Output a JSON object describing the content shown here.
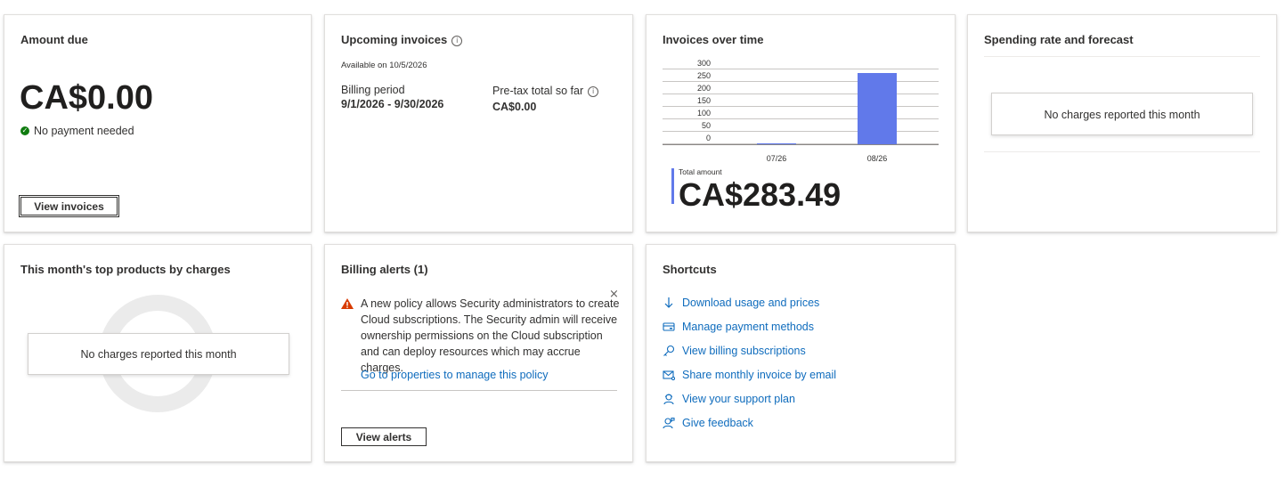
{
  "amount_due": {
    "title": "Amount due",
    "amount": "CA$0.00",
    "status": "No payment needed",
    "button": "View invoices"
  },
  "upcoming": {
    "title": "Upcoming invoices",
    "available": "Available on 10/5/2026",
    "billing_period_label": "Billing period",
    "billing_period_value": "9/1/2026 - 9/30/2026",
    "pretax_label": "Pre-tax total so far",
    "pretax_value": "CA$0.00"
  },
  "invoices_over_time": {
    "title": "Invoices over time",
    "total_label": "Total amount",
    "total_value": "CA$283.49"
  },
  "chart_data": {
    "type": "bar",
    "categories": [
      "07/26",
      "08/26"
    ],
    "values": [
      0,
      283.49
    ],
    "ylim": [
      0,
      300
    ],
    "yticks": [
      "300",
      "250",
      "200",
      "150",
      "100",
      "50",
      "0"
    ],
    "bar_color": "#6179ea",
    "grid": true
  },
  "spending": {
    "title": "Spending rate and forecast",
    "empty": "No charges reported this month"
  },
  "top_products": {
    "title": "This month's top products by charges",
    "empty": "No charges reported this month"
  },
  "alerts": {
    "title": "Billing alerts (1)",
    "message": "A new policy allows Security administrators to create Cloud subscriptions. The Security admin will receive ownership permissions on the Cloud subscription and can deploy resources which may accrue charges.",
    "link": "Go to properties to manage this policy",
    "button": "View alerts",
    "close": "×"
  },
  "shortcuts": {
    "title": "Shortcuts",
    "items": [
      {
        "label": "Download usage and prices",
        "icon": "download-icon"
      },
      {
        "label": "Manage payment methods",
        "icon": "payment-card-icon"
      },
      {
        "label": "View billing subscriptions",
        "icon": "key-icon"
      },
      {
        "label": "Share monthly invoice by email",
        "icon": "mail-icon"
      },
      {
        "label": "View your support plan",
        "icon": "support-person-icon"
      },
      {
        "label": "Give feedback",
        "icon": "feedback-person-icon"
      }
    ]
  },
  "colors": {
    "link": "#0f6cbd",
    "success": "#107c10",
    "warning": "#d83b01",
    "bar": "#6179ea",
    "total_accent": "#6179ea"
  }
}
